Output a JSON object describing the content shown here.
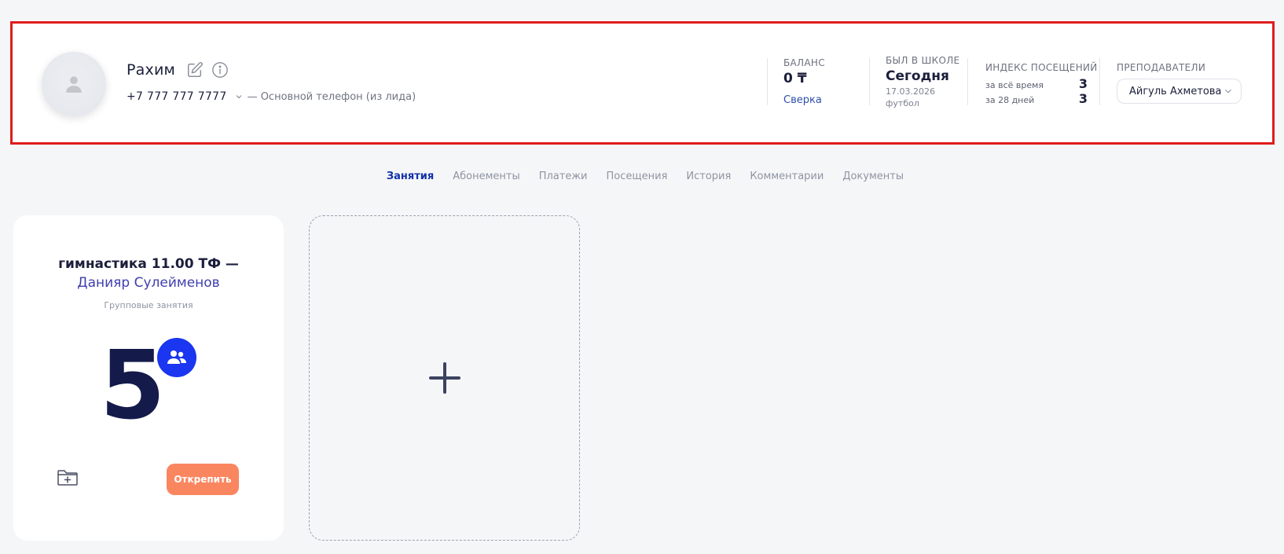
{
  "client": {
    "name": "Рахим",
    "phone": "+7 777 777 7777",
    "phone_note": "— Основной телефон (из лида)"
  },
  "balance": {
    "label": "БАЛАНС",
    "value": "0 ₸",
    "link": "Сверка"
  },
  "last_visit": {
    "label": "БЫЛ В ШКОЛЕ",
    "value": "Сегодня",
    "date": "17.03.2026",
    "activity": "футбол"
  },
  "attendance_index": {
    "label": "ИНДЕКС ПОСЕЩЕНИЙ",
    "all_time_label": "за всё время",
    "all_time_value": "3",
    "last_28_label": "за 28 дней",
    "last_28_value": "3"
  },
  "teachers": {
    "label": "ПРЕПОДАВАТЕЛИ",
    "selected": "Айгуль Ахметова"
  },
  "tabs": [
    {
      "label": "Занятия",
      "active": true
    },
    {
      "label": "Абонементы",
      "active": false
    },
    {
      "label": "Платежи",
      "active": false
    },
    {
      "label": "Посещения",
      "active": false
    },
    {
      "label": "История",
      "active": false
    },
    {
      "label": "Комментарии",
      "active": false
    },
    {
      "label": "Документы",
      "active": false
    }
  ],
  "course_card": {
    "title": "гимнастика 11.00 ТФ —",
    "teacher": "Данияр Сулейменов",
    "type": "Групповые занятия",
    "count": "5",
    "unpin_label": "Открепить"
  },
  "icons": {
    "avatar": "user-placeholder-icon",
    "edit": "edit-icon",
    "info": "info-icon",
    "phone_dropdown": "chevron-down-icon",
    "teacher_dropdown": "chevron-down-icon",
    "group": "group-users-icon",
    "folder_add": "folder-add-icon",
    "add": "plus-icon"
  },
  "colors": {
    "highlight_border": "#e01c1c",
    "active_tab": "#1232a8",
    "link": "#2f4eaa",
    "badge": "#1a36f0",
    "unpin_button": "#fa8660",
    "count": "#141a4a"
  }
}
